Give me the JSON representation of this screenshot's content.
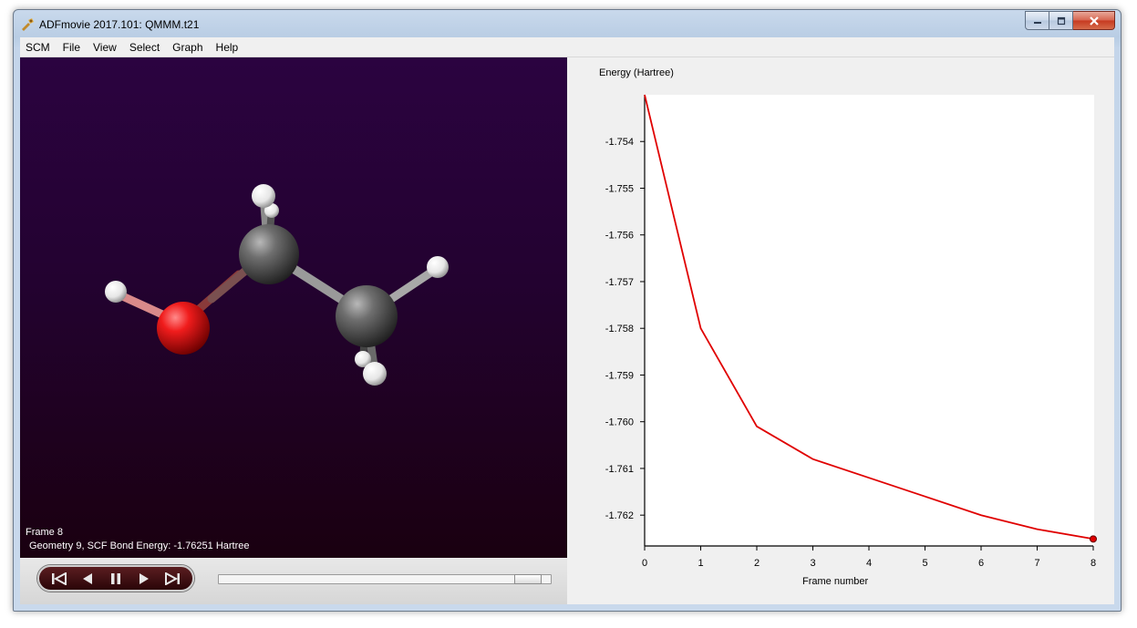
{
  "window": {
    "title": "ADFmovie 2017.101: QMMM.t21",
    "controls": {
      "minimize_icon": "minimize-icon",
      "maximize_icon": "restore-icon",
      "close_icon": "close-icon"
    }
  },
  "menubar": {
    "items": [
      "SCM",
      "File",
      "View",
      "Select",
      "Graph",
      "Help"
    ]
  },
  "viewer": {
    "frame_label": "Frame 8",
    "geometry_label": "Geometry 9, SCF Bond Energy: -1.76251 Hartree",
    "molecule": "ethanol",
    "atoms": [
      {
        "element": "H",
        "color": "#ffffff"
      },
      {
        "element": "O",
        "color": "#e01818"
      },
      {
        "element": "C",
        "color": "#5a5a5a"
      },
      {
        "element": "C",
        "color": "#5a5a5a"
      },
      {
        "element": "H",
        "color": "#ffffff"
      },
      {
        "element": "H",
        "color": "#ffffff"
      },
      {
        "element": "H",
        "color": "#ffffff"
      },
      {
        "element": "H",
        "color": "#ffffff"
      },
      {
        "element": "H",
        "color": "#ffffff"
      }
    ],
    "background_colors": [
      "#2b0340",
      "#1a0010"
    ]
  },
  "playback": {
    "buttons": [
      "first-frame-icon",
      "previous-frame-icon",
      "pause-icon",
      "next-frame-icon",
      "last-frame-icon"
    ],
    "slider_position": 0.97
  },
  "chart_data": {
    "type": "line",
    "ylabel": "Energy (Hartree)",
    "xlabel": "Frame number",
    "x": [
      0,
      1,
      2,
      3,
      4,
      5,
      6,
      7,
      8
    ],
    "series": [
      {
        "values": [
          -1.753,
          -1.758,
          -1.7601,
          -1.7608,
          -1.7612,
          -1.7616,
          -1.762,
          -1.7623,
          -1.76251
        ],
        "color": "#e00000"
      }
    ],
    "xticks": [
      "0",
      "1",
      "2",
      "3",
      "4",
      "5",
      "6",
      "7",
      "8"
    ],
    "yticks": [
      "-1.754",
      "-1.755",
      "-1.756",
      "-1.757",
      "-1.758",
      "-1.759",
      "-1.760",
      "-1.761",
      "-1.762"
    ],
    "ytick_values": [
      -1.754,
      -1.755,
      -1.756,
      -1.757,
      -1.758,
      -1.759,
      -1.76,
      -1.761,
      -1.762
    ],
    "xlim": [
      0,
      8
    ],
    "ylim": [
      -1.76266,
      -1.753
    ],
    "highlight_point": 8,
    "grid": false
  }
}
